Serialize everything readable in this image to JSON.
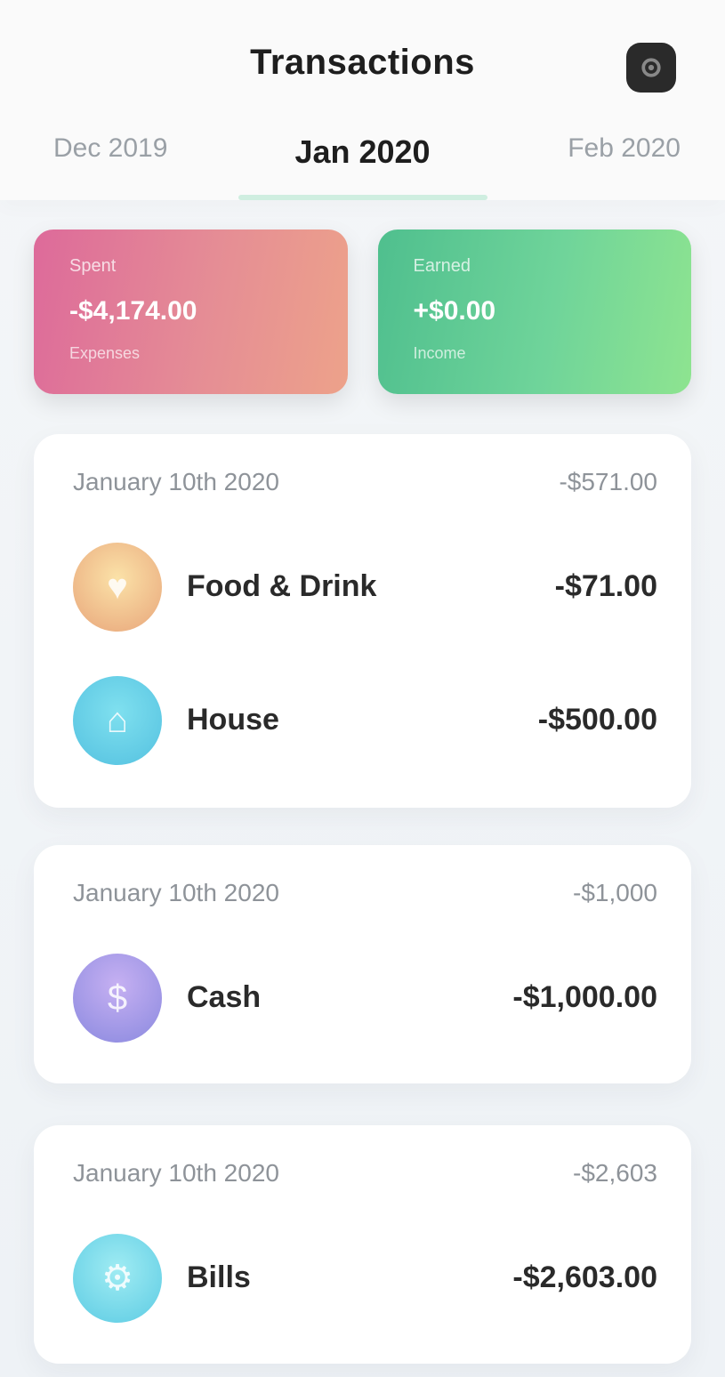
{
  "header": {
    "title": "Transactions",
    "settings_icon": "gear-icon"
  },
  "tabs": {
    "prev": "Dec 2019",
    "active": "Jan 2020",
    "next": "Feb 2020"
  },
  "summary": {
    "expense": {
      "label": "Spent",
      "value": "-$4,174.00",
      "sub": "Expenses"
    },
    "income": {
      "label": "Earned",
      "value": "+$0.00",
      "sub": "Income"
    }
  },
  "groups": [
    {
      "date": "January 10th 2020",
      "total": "-$571.00",
      "transactions": [
        {
          "name": "Food & Drink",
          "amount": "-$71.00",
          "icon": "food-icon",
          "color_a": "#f7d48a",
          "color_b": "#e9a77b"
        },
        {
          "name": "House",
          "amount": "-$500.00",
          "icon": "house-icon",
          "color_a": "#72d9ec",
          "color_b": "#5cc7e3"
        }
      ]
    },
    {
      "date": "January 10th 2020",
      "total": "-$1,000",
      "transactions": [
        {
          "name": "Cash",
          "amount": "-$1,000.00",
          "icon": "cash-icon",
          "color_a": "#b9a3ef",
          "color_b": "#8e8de0"
        }
      ]
    },
    {
      "date": "January 10th 2020",
      "total": "-$2,603",
      "transactions": [
        {
          "name": "Bills",
          "amount": "-$2,603.00",
          "icon": "bills-icon",
          "color_a": "#8ee6f0",
          "color_b": "#5fcce4"
        }
      ]
    }
  ]
}
